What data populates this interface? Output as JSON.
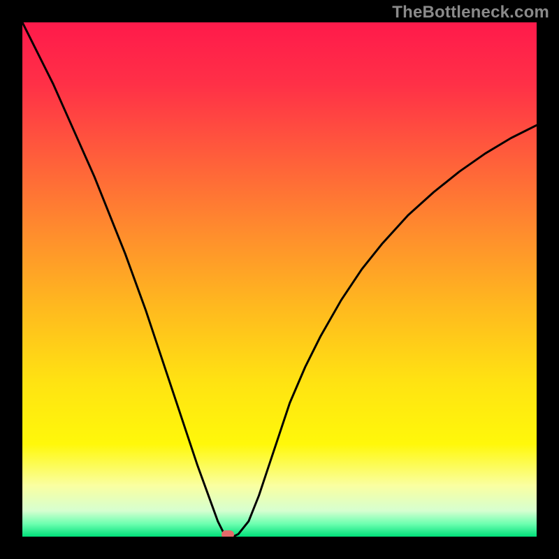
{
  "watermark": {
    "label": "TheBottleneck.com"
  },
  "chart_data": {
    "type": "line",
    "title": "",
    "xlabel": "",
    "ylabel": "",
    "xlim": [
      0,
      100
    ],
    "ylim": [
      0,
      100
    ],
    "x": [
      0,
      2,
      4,
      6,
      8,
      10,
      12,
      14,
      16,
      18,
      20,
      22,
      24,
      26,
      28,
      30,
      32,
      34,
      36,
      38,
      39,
      40,
      41,
      42,
      44,
      46,
      48,
      50,
      52,
      55,
      58,
      62,
      66,
      70,
      75,
      80,
      85,
      90,
      95,
      100
    ],
    "values": [
      100,
      96,
      92,
      88,
      83.5,
      79,
      74.5,
      70,
      65,
      60,
      55,
      49.5,
      44,
      38,
      32,
      26,
      20,
      14,
      8.5,
      3,
      1,
      0,
      0,
      0.5,
      3,
      8,
      14,
      20,
      26,
      33,
      39,
      46,
      52,
      57,
      62.5,
      67,
      71,
      74.5,
      77.5,
      80
    ],
    "optimum_x": 40,
    "gradient_stops": [
      {
        "pos": 0.0,
        "color": "#ff1a4b"
      },
      {
        "pos": 0.12,
        "color": "#ff3047"
      },
      {
        "pos": 0.25,
        "color": "#ff5a3c"
      },
      {
        "pos": 0.4,
        "color": "#ff8a2e"
      },
      {
        "pos": 0.55,
        "color": "#ffb81f"
      },
      {
        "pos": 0.7,
        "color": "#ffe312"
      },
      {
        "pos": 0.82,
        "color": "#fff80a"
      },
      {
        "pos": 0.9,
        "color": "#faffa0"
      },
      {
        "pos": 0.95,
        "color": "#d6ffd0"
      },
      {
        "pos": 0.975,
        "color": "#6dffb0"
      },
      {
        "pos": 1.0,
        "color": "#00e07a"
      }
    ],
    "marker_color": "#e46a6a",
    "curve_color": "#000000"
  }
}
